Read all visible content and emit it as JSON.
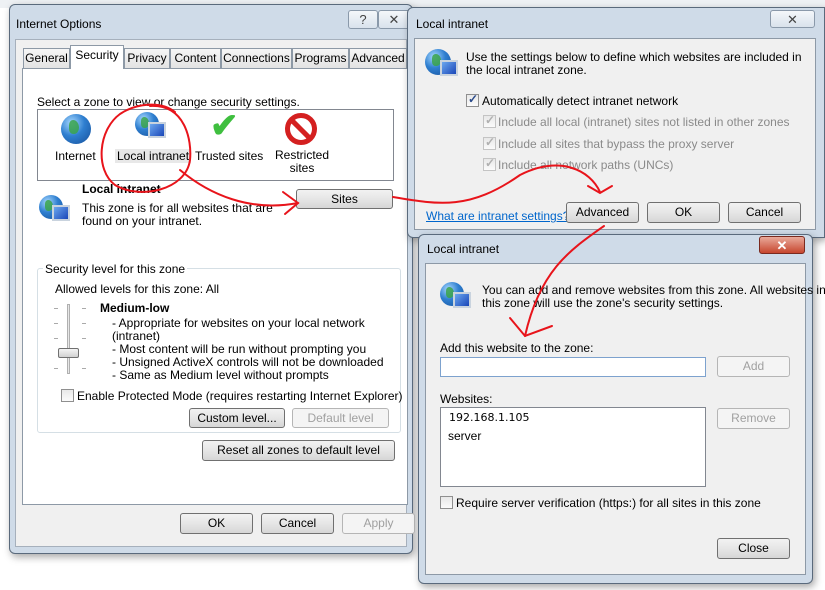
{
  "internet_options": {
    "title": "Internet Options",
    "help_glyph": "?",
    "close_glyph": "✕",
    "tabs": [
      {
        "label": "General"
      },
      {
        "label": "Security"
      },
      {
        "label": "Privacy"
      },
      {
        "label": "Content"
      },
      {
        "label": "Connections"
      },
      {
        "label": "Programs"
      },
      {
        "label": "Advanced"
      }
    ],
    "active_tab": "Security",
    "zone_prompt": "Select a zone to view or change security settings.",
    "zones": [
      {
        "label": "Internet",
        "icon": "globe-icon"
      },
      {
        "label": "Local intranet",
        "icon": "intranet-icon"
      },
      {
        "label": "Trusted sites",
        "icon": "checkmark-icon"
      },
      {
        "label": "Restricted sites",
        "label_line1": "Restricted",
        "label_line2": "sites",
        "icon": "restricted-icon"
      }
    ],
    "selected_zone": "Local intranet",
    "zone_name": "Local intranet",
    "zone_desc_line1": "This zone is for all websites that are",
    "zone_desc_line2": "found on your intranet.",
    "sites_button": "Sites",
    "security_group_label": "Security level for this zone",
    "allowed_levels": "Allowed levels for this zone: All",
    "level_name": "Medium-low",
    "level_slider_position": "2 of 5 (from bottom)",
    "level_bullets": [
      "- Appropriate for websites on your local network",
      "(intranet)",
      "- Most content will be run without prompting you",
      "- Unsigned ActiveX controls will not be downloaded",
      "- Same as Medium level without prompts"
    ],
    "protected_mode_label": "Enable Protected Mode (requires restarting Internet Explorer)",
    "protected_mode_checked": false,
    "custom_level_button": "Custom level...",
    "default_level_button": "Default level",
    "reset_all_button": "Reset all zones to default level",
    "ok_button": "OK",
    "cancel_button": "Cancel",
    "apply_button": "Apply"
  },
  "intranet_settings": {
    "title": "Local intranet",
    "close_glyph": "✕",
    "intro_line1": "Use the settings below to define which websites are included in",
    "intro_line2": "the local intranet zone.",
    "auto_detect_label": "Automatically detect intranet network",
    "auto_detect_checked": true,
    "options": [
      {
        "label": "Include all local (intranet) sites not listed in other zones",
        "checked": true,
        "disabled": true
      },
      {
        "label": "Include all sites that bypass the proxy server",
        "checked": true,
        "disabled": true
      },
      {
        "label": "Include all network paths (UNCs)",
        "checked": true,
        "disabled": true
      }
    ],
    "help_link": "What are intranet settings?",
    "advanced_button": "Advanced",
    "ok_button": "OK",
    "cancel_button": "Cancel"
  },
  "intranet_sites": {
    "title": "Local intranet",
    "close_glyph": "✕",
    "intro_line1": "You can add and remove websites from this zone. All websites in",
    "intro_line2": "this zone will use the zone's security settings.",
    "add_label": "Add this website to the zone:",
    "add_input_value": "",
    "add_button": "Add",
    "websites_label": "Websites:",
    "websites": [
      "192.168.1.105",
      "server"
    ],
    "remove_button": "Remove",
    "require_https_label": "Require server verification (https:) for all sites in this zone",
    "require_https_checked": false,
    "close_button": "Close"
  },
  "annotation_color": "#e8141b"
}
